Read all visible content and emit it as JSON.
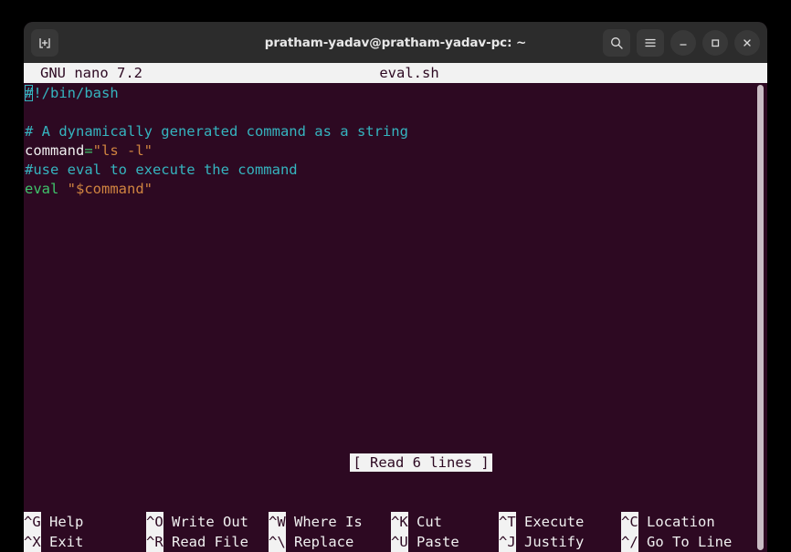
{
  "window": {
    "title": "pratham-yadav@pratham-yadav-pc: ~",
    "new_tab_icon": "new-tab-icon",
    "search_icon": "search-icon",
    "menu_icon": "hamburger-menu-icon",
    "minimize_icon": "minimize-icon",
    "maximize_icon": "maximize-icon",
    "close_icon": "close-icon",
    "titlebar_bg": "#2c2c2c",
    "terminal_bg": "#2d0922"
  },
  "nano": {
    "app_title": "GNU nano 7.2",
    "filename": "eval.sh",
    "status_message": "[ Read 6 lines ]",
    "colors": {
      "comment": "#35b4bf",
      "plain": "#f0f0f0",
      "operator": "#3fc46b",
      "string": "#d08440",
      "keyword": "#3fc46b",
      "cursor": "#35b4bf"
    },
    "lines": [
      {
        "cursor_at": 0,
        "tokens": [
          {
            "text": "#",
            "style": "comment"
          },
          {
            "text": "!/bin/bash",
            "style": "comment"
          }
        ]
      },
      {
        "tokens": []
      },
      {
        "tokens": [
          {
            "text": "# A dynamically generated command as a string",
            "style": "comment"
          }
        ]
      },
      {
        "tokens": [
          {
            "text": "command",
            "style": "plain"
          },
          {
            "text": "=",
            "style": "operator"
          },
          {
            "text": "\"ls -l\"",
            "style": "string"
          }
        ]
      },
      {
        "tokens": [
          {
            "text": "#use eval to execute the command",
            "style": "comment"
          }
        ]
      },
      {
        "tokens": [
          {
            "text": "eval",
            "style": "keyword"
          },
          {
            "text": " ",
            "style": "plain"
          },
          {
            "text": "\"$command\"",
            "style": "string"
          }
        ]
      }
    ]
  },
  "help_bar": {
    "rows": [
      [
        {
          "key": "^G",
          "label": "Help"
        },
        {
          "key": "^O",
          "label": "Write Out"
        },
        {
          "key": "^W",
          "label": "Where Is"
        },
        {
          "key": "^K",
          "label": "Cut"
        },
        {
          "key": "^T",
          "label": "Execute"
        },
        {
          "key": "^C",
          "label": "Location"
        }
      ],
      [
        {
          "key": "^X",
          "label": "Exit"
        },
        {
          "key": "^R",
          "label": "Read File"
        },
        {
          "key": "^\\",
          "label": "Replace"
        },
        {
          "key": "^U",
          "label": "Paste"
        },
        {
          "key": "^J",
          "label": "Justify"
        },
        {
          "key": "^/",
          "label": "Go To Line"
        }
      ]
    ],
    "column_offsets": [
      0,
      134,
      268,
      402,
      520,
      654
    ]
  },
  "scrollbar": {
    "name": "vertical-scrollbar"
  }
}
